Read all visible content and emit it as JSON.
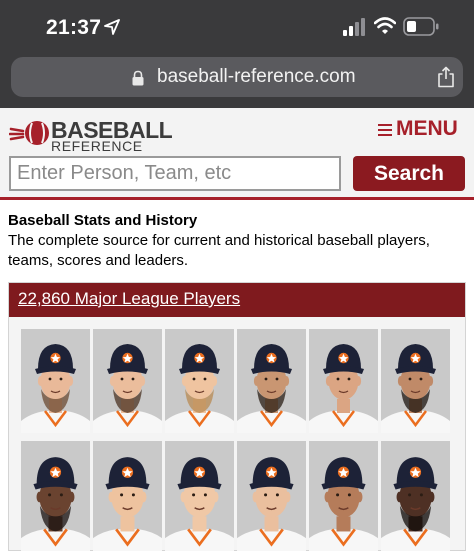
{
  "status_bar": {
    "time": "21:37",
    "icons": [
      "location-arrow-icon",
      "cellular-signal-icon",
      "wifi-icon",
      "battery-icon"
    ]
  },
  "browser": {
    "url": "baseball-reference.com",
    "icons": [
      "lock-icon",
      "share-icon"
    ]
  },
  "site": {
    "logo_line1": "BASEBALL",
    "logo_line2": "REFERENCE",
    "menu_label": "MENU",
    "search_placeholder": "Enter Person, Team, etc",
    "search_button": "Search"
  },
  "intro": {
    "title": "Baseball Stats and History",
    "text": "The complete source for current and historical baseball players, teams, scores and leaders."
  },
  "players": {
    "heading": "22,860 Major League Players",
    "headshots": [
      {
        "skin": "#e9b999",
        "hair": "#6b4a32",
        "beard": true
      },
      {
        "skin": "#ebbd9c",
        "hair": "#4a3222",
        "beard": true
      },
      {
        "skin": "#efc4a0",
        "hair": "#b88a52",
        "beard": true
      },
      {
        "skin": "#c99672",
        "hair": "#2a1d14",
        "beard": true
      },
      {
        "skin": "#dba583",
        "hair": "#2b2018",
        "beard": false
      },
      {
        "skin": "#c08a68",
        "hair": "#1c140f",
        "beard": true
      },
      {
        "skin": "#6a4330",
        "hair": "#1a1210",
        "beard": true
      },
      {
        "skin": "#eec39f",
        "hair": "#8a5c2e",
        "beard": false
      },
      {
        "skin": "#f0c8a6",
        "hair": "#c89a5e",
        "beard": false
      },
      {
        "skin": "#eabf9e",
        "hair": "#9a7448",
        "beard": false
      },
      {
        "skin": "#b57c5a",
        "hair": "#1c140f",
        "beard": false
      },
      {
        "skin": "#4e3024",
        "hair": "#120c0a",
        "beard": true
      }
    ]
  },
  "colors": {
    "brand_red": "#a6202a",
    "module_header": "#7f1a1e",
    "search_button": "#8b1a20",
    "cap_navy": "#1d2237",
    "cap_orange": "#eb6e1f"
  }
}
